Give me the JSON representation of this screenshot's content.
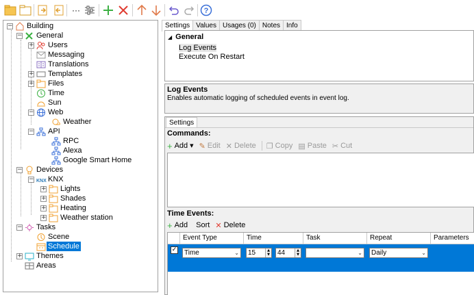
{
  "toolbar": {
    "buttons": [
      "new-icon",
      "open-icon",
      "import-icon",
      "export-icon",
      "more-icon",
      "settings-sliders-icon",
      "add-icon",
      "delete-icon",
      "move-up-icon",
      "move-down-icon",
      "undo-icon",
      "redo-icon",
      "help-icon"
    ]
  },
  "tree": {
    "items": [
      {
        "label": "Building",
        "icon": "building-icon"
      },
      {
        "label": "General",
        "icon": "general-icon"
      },
      {
        "label": "Users",
        "icon": "users-icon"
      },
      {
        "label": "Messaging",
        "icon": "messaging-icon"
      },
      {
        "label": "Translations",
        "icon": "translations-icon"
      },
      {
        "label": "Templates",
        "icon": "templates-icon"
      },
      {
        "label": "Files",
        "icon": "folder-icon"
      },
      {
        "label": "Time",
        "icon": "clock-icon"
      },
      {
        "label": "Sun",
        "icon": "sun-icon"
      },
      {
        "label": "Web",
        "icon": "globe-icon"
      },
      {
        "label": "Weather",
        "icon": "weather-icon"
      },
      {
        "label": "API",
        "icon": "api-icon"
      },
      {
        "label": "RPC",
        "icon": "network-icon"
      },
      {
        "label": "Alexa",
        "icon": "network-icon"
      },
      {
        "label": "Google Smart Home",
        "icon": "network-icon"
      },
      {
        "label": "Devices",
        "icon": "devices-icon"
      },
      {
        "label": "KNX",
        "icon": "knx-icon"
      },
      {
        "label": "Lights",
        "icon": "folder-icon"
      },
      {
        "label": "Shades",
        "icon": "folder-icon"
      },
      {
        "label": "Heating",
        "icon": "folder-icon"
      },
      {
        "label": "Weather station",
        "icon": "folder-icon"
      },
      {
        "label": "Tasks",
        "icon": "tasks-icon"
      },
      {
        "label": "Scene",
        "icon": "scene-icon"
      },
      {
        "label": "Schedule",
        "icon": "schedule-icon"
      },
      {
        "label": "Themes",
        "icon": "themes-icon"
      },
      {
        "label": "Areas",
        "icon": "areas-icon"
      }
    ]
  },
  "tabs": [
    "Settings",
    "Values",
    "Usages (0)",
    "Notes",
    "Info"
  ],
  "property_grid": {
    "category": "General",
    "items": [
      "Log Events",
      "Execute On Restart"
    ]
  },
  "description": {
    "title": "Log Events",
    "text": "Enables automatic logging of scheduled events in event log."
  },
  "settings": {
    "inner_tab": "Settings",
    "commands_label": "Commands:",
    "commands_toolbar": [
      "Add",
      "Edit",
      "Delete",
      "Copy",
      "Paste",
      "Cut"
    ],
    "time_events_label": "Time Events:",
    "time_events_toolbar": [
      "Add",
      "Sort",
      "Delete"
    ],
    "columns": [
      "Event Type",
      "Time",
      "Task",
      "Repeat",
      "Parameters"
    ],
    "row": {
      "checked": true,
      "event_type": "Time",
      "hour": "15",
      "minute": "44",
      "task": "",
      "repeat": "Daily"
    }
  },
  "colors": {
    "selection": "#0078d7",
    "accent_green": "#3cb043",
    "accent_red": "#e03c31",
    "accent_orange": "#f0a030"
  }
}
